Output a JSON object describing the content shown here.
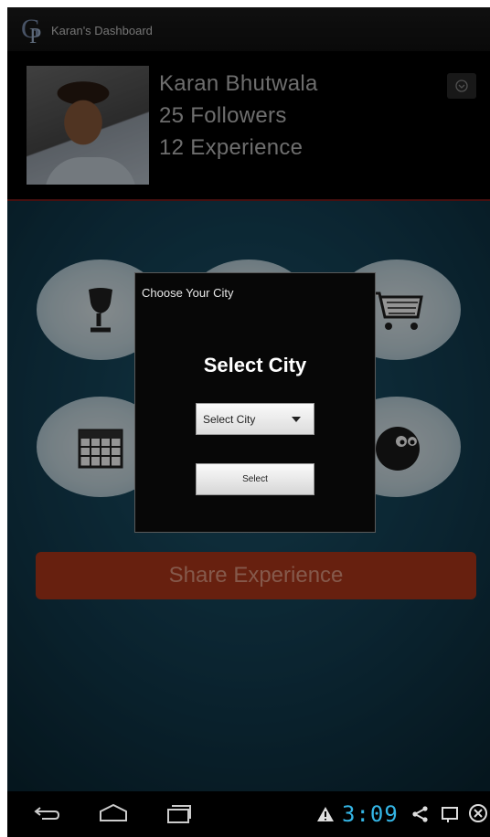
{
  "titlebar": {
    "title": "Karan's Dashboard",
    "logo_icon": "gp-logo-icon"
  },
  "profile": {
    "name": "Karan Bhutwala",
    "followers": "25 Followers",
    "experience": "12 Experience",
    "menu_icon": "chevron-down-circle-icon"
  },
  "tiles": [
    {
      "icon": "wine-glass-icon"
    },
    {
      "icon": "restaurant-icon"
    },
    {
      "icon": "shopping-cart-icon"
    },
    {
      "icon": "calendar-icon"
    },
    {
      "icon": "building-icon"
    },
    {
      "icon": "face-icon"
    }
  ],
  "share_button": {
    "label": "Share Experience"
  },
  "dialog": {
    "title": "Choose Your City",
    "heading": "Select City",
    "select_value": "Select City",
    "button_label": "Select"
  },
  "statusbar": {
    "time": "3:09"
  },
  "colors": {
    "accent": "#34b5e5",
    "share_button": "#b2381a",
    "header_divider": "#7a1c1c"
  }
}
